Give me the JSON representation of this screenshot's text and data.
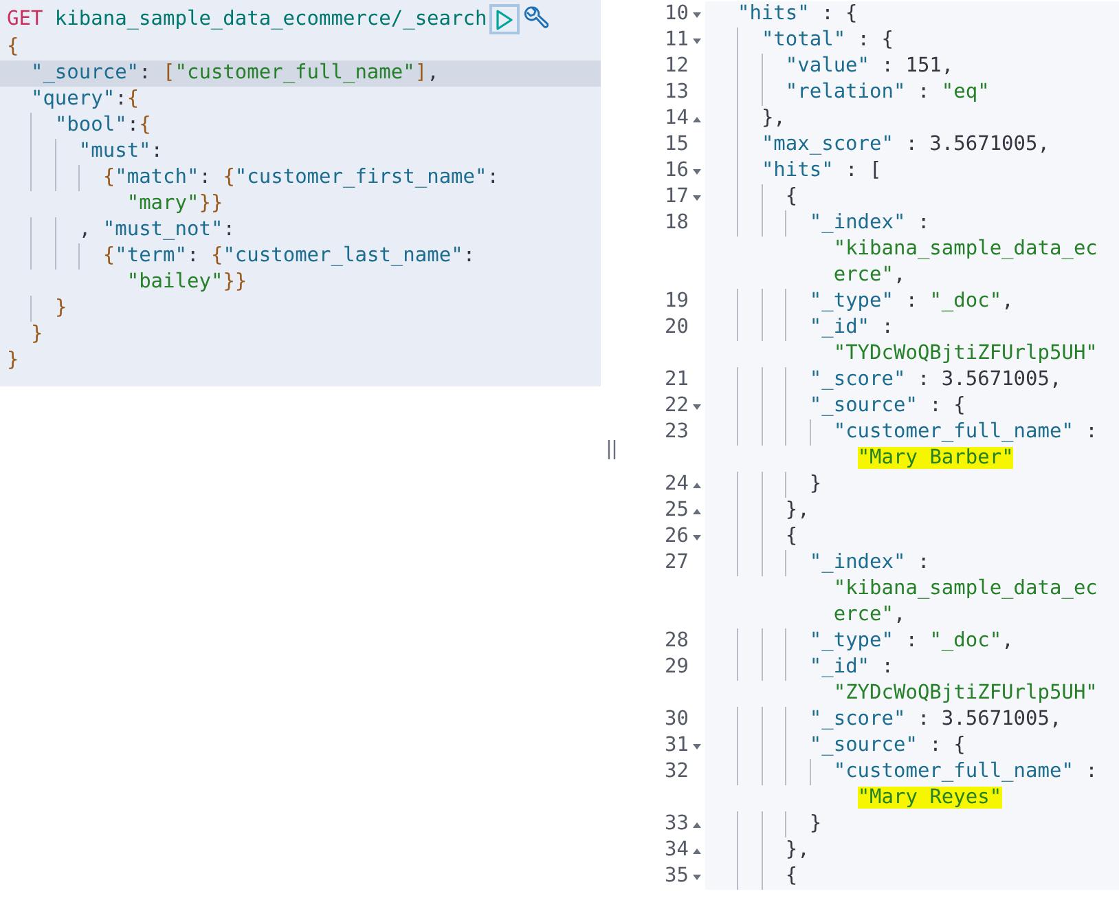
{
  "request": {
    "lines": [
      {
        "kind": "code",
        "active": false,
        "segs": [
          {
            "kind": "method",
            "text": "GET"
          },
          {
            "kind": "path",
            "text": " kibana_sample_data_ecommerce/_search"
          }
        ]
      },
      {
        "kind": "code",
        "active": false,
        "segs": [
          {
            "kind": "brace",
            "text": "{"
          }
        ]
      },
      {
        "kind": "code",
        "active": true,
        "segs": [
          {
            "kind": "key",
            "text": "  \"_source\""
          },
          {
            "kind": "punct",
            "text": ": "
          },
          {
            "kind": "brace",
            "text": "["
          },
          {
            "kind": "str",
            "text": "\"customer_full_name\""
          },
          {
            "kind": "brace",
            "text": "]"
          },
          {
            "kind": "punct",
            "text": ","
          }
        ]
      },
      {
        "kind": "code",
        "active": false,
        "segs": [
          {
            "kind": "key",
            "text": "  \"query\""
          },
          {
            "kind": "punct",
            "text": ":"
          },
          {
            "kind": "brace",
            "text": "{"
          }
        ]
      },
      {
        "kind": "code",
        "active": false,
        "segs": [
          {
            "kind": "key",
            "text": "    \"bool\""
          },
          {
            "kind": "punct",
            "text": ":"
          },
          {
            "kind": "brace",
            "text": "{"
          }
        ]
      },
      {
        "kind": "code",
        "active": false,
        "segs": [
          {
            "kind": "key",
            "text": "      \"must\""
          },
          {
            "kind": "punct",
            "text": ":"
          }
        ]
      },
      {
        "kind": "code",
        "active": false,
        "segs": [
          {
            "kind": "brace",
            "text": "        {"
          },
          {
            "kind": "key",
            "text": "\"match\""
          },
          {
            "kind": "punct",
            "text": ": "
          },
          {
            "kind": "brace",
            "text": "{"
          },
          {
            "kind": "key",
            "text": "\"customer_first_name\""
          },
          {
            "kind": "punct",
            "text": ":"
          }
        ]
      },
      {
        "kind": "wrap",
        "active": false,
        "segs": [
          {
            "kind": "str",
            "text": "          \"mary\""
          },
          {
            "kind": "brace",
            "text": "}}"
          }
        ]
      },
      {
        "kind": "code",
        "active": false,
        "segs": [
          {
            "kind": "punct",
            "text": "      , "
          },
          {
            "kind": "key",
            "text": "\"must_not\""
          },
          {
            "kind": "punct",
            "text": ":"
          }
        ]
      },
      {
        "kind": "code",
        "active": false,
        "segs": [
          {
            "kind": "brace",
            "text": "        {"
          },
          {
            "kind": "key",
            "text": "\"term\""
          },
          {
            "kind": "punct",
            "text": ": "
          },
          {
            "kind": "brace",
            "text": "{"
          },
          {
            "kind": "key",
            "text": "\"customer_last_name\""
          },
          {
            "kind": "punct",
            "text": ":"
          }
        ]
      },
      {
        "kind": "wrap",
        "active": false,
        "segs": [
          {
            "kind": "str",
            "text": "          \"bailey\""
          },
          {
            "kind": "brace",
            "text": "}}"
          }
        ]
      },
      {
        "kind": "code",
        "active": false,
        "segs": [
          {
            "kind": "brace",
            "text": "    }"
          }
        ]
      },
      {
        "kind": "code",
        "active": false,
        "segs": [
          {
            "kind": "brace",
            "text": "  }"
          }
        ]
      },
      {
        "kind": "code",
        "active": false,
        "segs": [
          {
            "kind": "brace",
            "text": "}"
          }
        ]
      }
    ]
  },
  "response": {
    "lines": [
      {
        "number": "10",
        "kind": "start",
        "segs": [
          {
            "kind": "key",
            "text": "  \"hits\""
          },
          {
            "kind": "punct",
            "text": " : {"
          }
        ]
      },
      {
        "number": "11",
        "kind": "start",
        "segs": [
          {
            "kind": "key",
            "text": "    \"total\""
          },
          {
            "kind": "punct",
            "text": " : {"
          }
        ]
      },
      {
        "number": "12",
        "kind": "plain",
        "segs": [
          {
            "kind": "key",
            "text": "      \"value\""
          },
          {
            "kind": "punct",
            "text": " : "
          },
          {
            "kind": "num",
            "text": "151"
          },
          {
            "kind": "punct",
            "text": ","
          }
        ]
      },
      {
        "number": "13",
        "kind": "plain",
        "segs": [
          {
            "kind": "key",
            "text": "      \"relation\""
          },
          {
            "kind": "punct",
            "text": " : "
          },
          {
            "kind": "str",
            "text": "\"eq\""
          }
        ]
      },
      {
        "number": "14",
        "kind": "end",
        "segs": [
          {
            "kind": "punct",
            "text": "    },"
          }
        ]
      },
      {
        "number": "15",
        "kind": "plain",
        "segs": [
          {
            "kind": "key",
            "text": "    \"max_score\""
          },
          {
            "kind": "punct",
            "text": " : "
          },
          {
            "kind": "num",
            "text": "3.5671005"
          },
          {
            "kind": "punct",
            "text": ","
          }
        ]
      },
      {
        "number": "16",
        "kind": "start",
        "segs": [
          {
            "kind": "key",
            "text": "    \"hits\""
          },
          {
            "kind": "punct",
            "text": " : ["
          }
        ]
      },
      {
        "number": "17",
        "kind": "start",
        "segs": [
          {
            "kind": "punct",
            "text": "      {"
          }
        ]
      },
      {
        "number": "18",
        "kind": "plain",
        "segs": [
          {
            "kind": "key",
            "text": "        \"_index\""
          },
          {
            "kind": "punct",
            "text": " :"
          }
        ]
      },
      {
        "kind": "wrap",
        "segs": [
          {
            "kind": "str",
            "text": "          \"kibana_sample_data_ec"
          }
        ]
      },
      {
        "kind": "wrap",
        "segs": [
          {
            "kind": "str",
            "text": "          erce\""
          },
          {
            "kind": "punct",
            "text": ","
          }
        ]
      },
      {
        "number": "19",
        "kind": "plain",
        "segs": [
          {
            "kind": "key",
            "text": "        \"_type\""
          },
          {
            "kind": "punct",
            "text": " : "
          },
          {
            "kind": "str",
            "text": "\"_doc\""
          },
          {
            "kind": "punct",
            "text": ","
          }
        ]
      },
      {
        "number": "20",
        "kind": "plain",
        "segs": [
          {
            "kind": "key",
            "text": "        \"_id\""
          },
          {
            "kind": "punct",
            "text": " :"
          }
        ]
      },
      {
        "kind": "wrap",
        "segs": [
          {
            "kind": "str",
            "text": "          \"TYDcWoQBjtiZFUrlp5UH\""
          }
        ]
      },
      {
        "number": "21",
        "kind": "plain",
        "segs": [
          {
            "kind": "key",
            "text": "        \"_score\""
          },
          {
            "kind": "punct",
            "text": " : "
          },
          {
            "kind": "num",
            "text": "3.5671005"
          },
          {
            "kind": "punct",
            "text": ","
          }
        ]
      },
      {
        "number": "22",
        "kind": "start",
        "segs": [
          {
            "kind": "key",
            "text": "        \"_source\""
          },
          {
            "kind": "punct",
            "text": " : {"
          }
        ]
      },
      {
        "number": "23",
        "kind": "plain",
        "segs": [
          {
            "kind": "key",
            "text": "          \"customer_full_name\""
          },
          {
            "kind": "punct",
            "text": " :"
          }
        ]
      },
      {
        "kind": "wrap",
        "segs": [
          {
            "kind": "str",
            "text": "            \"Mary Barber\"",
            "highlighted": true
          }
        ]
      },
      {
        "number": "24",
        "kind": "end",
        "segs": [
          {
            "kind": "punct",
            "text": "        }"
          }
        ]
      },
      {
        "number": "25",
        "kind": "end",
        "segs": [
          {
            "kind": "punct",
            "text": "      },"
          }
        ]
      },
      {
        "number": "26",
        "kind": "start",
        "segs": [
          {
            "kind": "punct",
            "text": "      {"
          }
        ]
      },
      {
        "number": "27",
        "kind": "plain",
        "segs": [
          {
            "kind": "key",
            "text": "        \"_index\""
          },
          {
            "kind": "punct",
            "text": " :"
          }
        ]
      },
      {
        "kind": "wrap",
        "segs": [
          {
            "kind": "str",
            "text": "          \"kibana_sample_data_ec"
          }
        ]
      },
      {
        "kind": "wrap",
        "segs": [
          {
            "kind": "str",
            "text": "          erce\""
          },
          {
            "kind": "punct",
            "text": ","
          }
        ]
      },
      {
        "number": "28",
        "kind": "plain",
        "segs": [
          {
            "kind": "key",
            "text": "        \"_type\""
          },
          {
            "kind": "punct",
            "text": " : "
          },
          {
            "kind": "str",
            "text": "\"_doc\""
          },
          {
            "kind": "punct",
            "text": ","
          }
        ]
      },
      {
        "number": "29",
        "kind": "plain",
        "segs": [
          {
            "kind": "key",
            "text": "        \"_id\""
          },
          {
            "kind": "punct",
            "text": " :"
          }
        ]
      },
      {
        "kind": "wrap",
        "segs": [
          {
            "kind": "str",
            "text": "          \"ZYDcWoQBjtiZFUrlp5UH\""
          }
        ]
      },
      {
        "number": "30",
        "kind": "plain",
        "segs": [
          {
            "kind": "key",
            "text": "        \"_score\""
          },
          {
            "kind": "punct",
            "text": " : "
          },
          {
            "kind": "num",
            "text": "3.5671005"
          },
          {
            "kind": "punct",
            "text": ","
          }
        ]
      },
      {
        "number": "31",
        "kind": "start",
        "segs": [
          {
            "kind": "key",
            "text": "        \"_source\""
          },
          {
            "kind": "punct",
            "text": " : {"
          }
        ]
      },
      {
        "number": "32",
        "kind": "plain",
        "segs": [
          {
            "kind": "key",
            "text": "          \"customer_full_name\""
          },
          {
            "kind": "punct",
            "text": " :"
          }
        ]
      },
      {
        "kind": "wrap",
        "segs": [
          {
            "kind": "str",
            "text": "            \"Mary Reyes\"",
            "highlighted": true
          }
        ]
      },
      {
        "number": "33",
        "kind": "end",
        "segs": [
          {
            "kind": "punct",
            "text": "        }"
          }
        ]
      },
      {
        "number": "34",
        "kind": "end",
        "segs": [
          {
            "kind": "punct",
            "text": "      },"
          }
        ]
      },
      {
        "number": "35",
        "kind": "start",
        "segs": [
          {
            "kind": "punct",
            "text": "      {"
          }
        ]
      }
    ]
  }
}
